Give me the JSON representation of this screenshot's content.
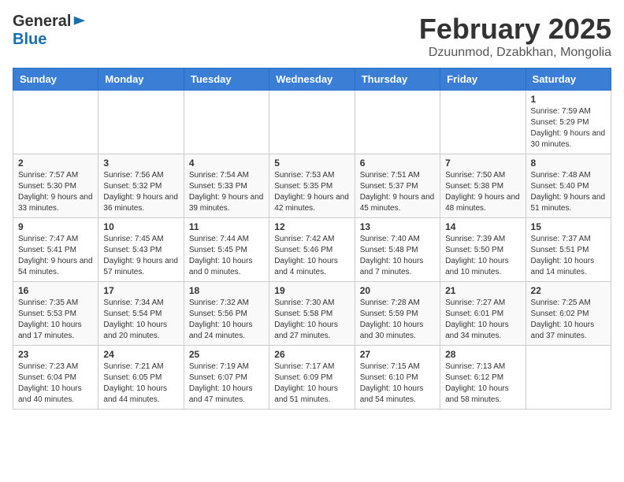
{
  "header": {
    "logo_general": "General",
    "logo_blue": "Blue",
    "month_title": "February 2025",
    "location": "Dzuunmod, Dzabkhan, Mongolia"
  },
  "days_of_week": [
    "Sunday",
    "Monday",
    "Tuesday",
    "Wednesday",
    "Thursday",
    "Friday",
    "Saturday"
  ],
  "weeks": [
    [
      {
        "day": "",
        "info": ""
      },
      {
        "day": "",
        "info": ""
      },
      {
        "day": "",
        "info": ""
      },
      {
        "day": "",
        "info": ""
      },
      {
        "day": "",
        "info": ""
      },
      {
        "day": "",
        "info": ""
      },
      {
        "day": "1",
        "info": "Sunrise: 7:59 AM\nSunset: 5:29 PM\nDaylight: 9 hours and 30 minutes."
      }
    ],
    [
      {
        "day": "2",
        "info": "Sunrise: 7:57 AM\nSunset: 5:30 PM\nDaylight: 9 hours and 33 minutes."
      },
      {
        "day": "3",
        "info": "Sunrise: 7:56 AM\nSunset: 5:32 PM\nDaylight: 9 hours and 36 minutes."
      },
      {
        "day": "4",
        "info": "Sunrise: 7:54 AM\nSunset: 5:33 PM\nDaylight: 9 hours and 39 minutes."
      },
      {
        "day": "5",
        "info": "Sunrise: 7:53 AM\nSunset: 5:35 PM\nDaylight: 9 hours and 42 minutes."
      },
      {
        "day": "6",
        "info": "Sunrise: 7:51 AM\nSunset: 5:37 PM\nDaylight: 9 hours and 45 minutes."
      },
      {
        "day": "7",
        "info": "Sunrise: 7:50 AM\nSunset: 5:38 PM\nDaylight: 9 hours and 48 minutes."
      },
      {
        "day": "8",
        "info": "Sunrise: 7:48 AM\nSunset: 5:40 PM\nDaylight: 9 hours and 51 minutes."
      }
    ],
    [
      {
        "day": "9",
        "info": "Sunrise: 7:47 AM\nSunset: 5:41 PM\nDaylight: 9 hours and 54 minutes."
      },
      {
        "day": "10",
        "info": "Sunrise: 7:45 AM\nSunset: 5:43 PM\nDaylight: 9 hours and 57 minutes."
      },
      {
        "day": "11",
        "info": "Sunrise: 7:44 AM\nSunset: 5:45 PM\nDaylight: 10 hours and 0 minutes."
      },
      {
        "day": "12",
        "info": "Sunrise: 7:42 AM\nSunset: 5:46 PM\nDaylight: 10 hours and 4 minutes."
      },
      {
        "day": "13",
        "info": "Sunrise: 7:40 AM\nSunset: 5:48 PM\nDaylight: 10 hours and 7 minutes."
      },
      {
        "day": "14",
        "info": "Sunrise: 7:39 AM\nSunset: 5:50 PM\nDaylight: 10 hours and 10 minutes."
      },
      {
        "day": "15",
        "info": "Sunrise: 7:37 AM\nSunset: 5:51 PM\nDaylight: 10 hours and 14 minutes."
      }
    ],
    [
      {
        "day": "16",
        "info": "Sunrise: 7:35 AM\nSunset: 5:53 PM\nDaylight: 10 hours and 17 minutes."
      },
      {
        "day": "17",
        "info": "Sunrise: 7:34 AM\nSunset: 5:54 PM\nDaylight: 10 hours and 20 minutes."
      },
      {
        "day": "18",
        "info": "Sunrise: 7:32 AM\nSunset: 5:56 PM\nDaylight: 10 hours and 24 minutes."
      },
      {
        "day": "19",
        "info": "Sunrise: 7:30 AM\nSunset: 5:58 PM\nDaylight: 10 hours and 27 minutes."
      },
      {
        "day": "20",
        "info": "Sunrise: 7:28 AM\nSunset: 5:59 PM\nDaylight: 10 hours and 30 minutes."
      },
      {
        "day": "21",
        "info": "Sunrise: 7:27 AM\nSunset: 6:01 PM\nDaylight: 10 hours and 34 minutes."
      },
      {
        "day": "22",
        "info": "Sunrise: 7:25 AM\nSunset: 6:02 PM\nDaylight: 10 hours and 37 minutes."
      }
    ],
    [
      {
        "day": "23",
        "info": "Sunrise: 7:23 AM\nSunset: 6:04 PM\nDaylight: 10 hours and 40 minutes."
      },
      {
        "day": "24",
        "info": "Sunrise: 7:21 AM\nSunset: 6:05 PM\nDaylight: 10 hours and 44 minutes."
      },
      {
        "day": "25",
        "info": "Sunrise: 7:19 AM\nSunset: 6:07 PM\nDaylight: 10 hours and 47 minutes."
      },
      {
        "day": "26",
        "info": "Sunrise: 7:17 AM\nSunset: 6:09 PM\nDaylight: 10 hours and 51 minutes."
      },
      {
        "day": "27",
        "info": "Sunrise: 7:15 AM\nSunset: 6:10 PM\nDaylight: 10 hours and 54 minutes."
      },
      {
        "day": "28",
        "info": "Sunrise: 7:13 AM\nSunset: 6:12 PM\nDaylight: 10 hours and 58 minutes."
      },
      {
        "day": "",
        "info": ""
      }
    ]
  ]
}
